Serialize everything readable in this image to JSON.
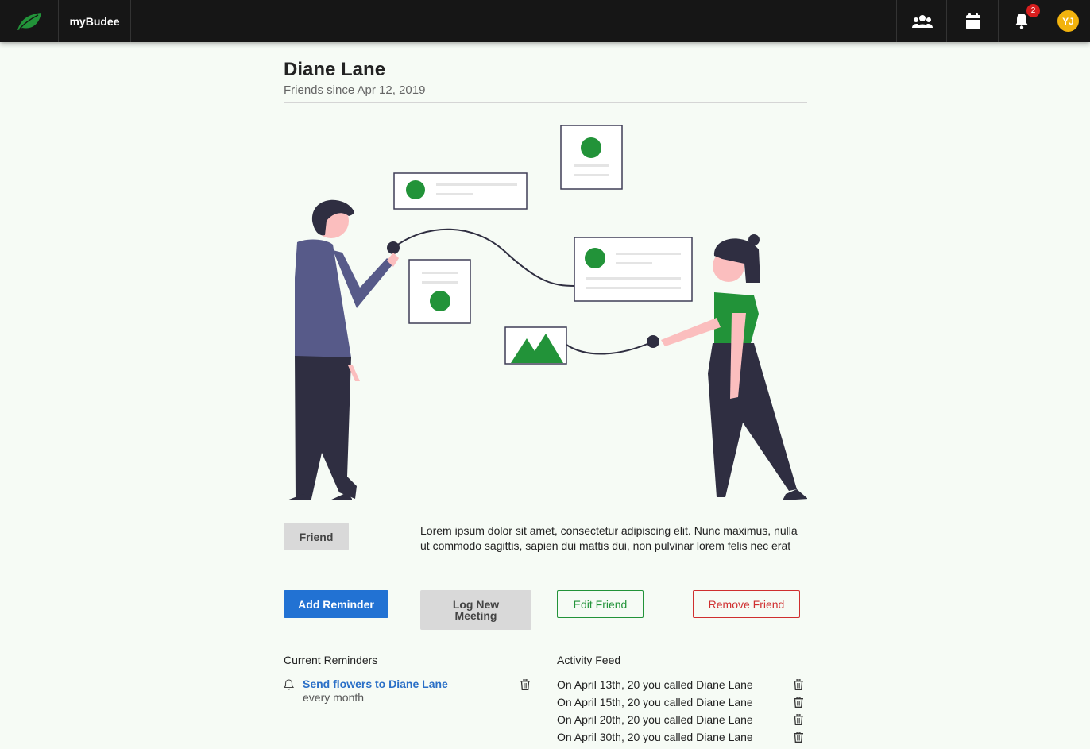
{
  "app": {
    "brand": "myBudee",
    "notification_count": "2",
    "user_initials": "YJ"
  },
  "profile": {
    "name": "Diane Lane",
    "friends_since": "Friends since Apr 12, 2019",
    "status_button": "Friend",
    "bio": "Lorem ipsum dolor sit amet, consectetur adipiscing elit. Nunc maximus, nulla ut commodo sagittis, sapien dui mattis dui, non pulvinar lorem felis nec erat"
  },
  "actions": {
    "add_reminder": "Add Reminder",
    "log_meeting": "Log New Meeting",
    "edit_friend": "Edit Friend",
    "remove_friend": "Remove Friend"
  },
  "reminders": {
    "heading": "Current Reminders",
    "items": [
      {
        "title": "Send flowers to Diane Lane",
        "frequency": "every month"
      }
    ]
  },
  "activity_feed": {
    "heading": "Activity Feed",
    "items": [
      "On April 13th, 20 you called Diane Lane",
      "On April 15th, 20 you called Diane Lane",
      "On April 20th, 20 you called Diane Lane",
      "On April 30th, 20 you called Diane Lane"
    ]
  },
  "colors": {
    "accent_green": "#229339",
    "primary_blue": "#2272d3",
    "danger_red": "#cf2f2f",
    "avatar_yellow": "#f2b30d"
  },
  "icons": [
    "leaf-icon",
    "friends-icon",
    "calendar-icon",
    "bell-icon",
    "trash-icon"
  ]
}
